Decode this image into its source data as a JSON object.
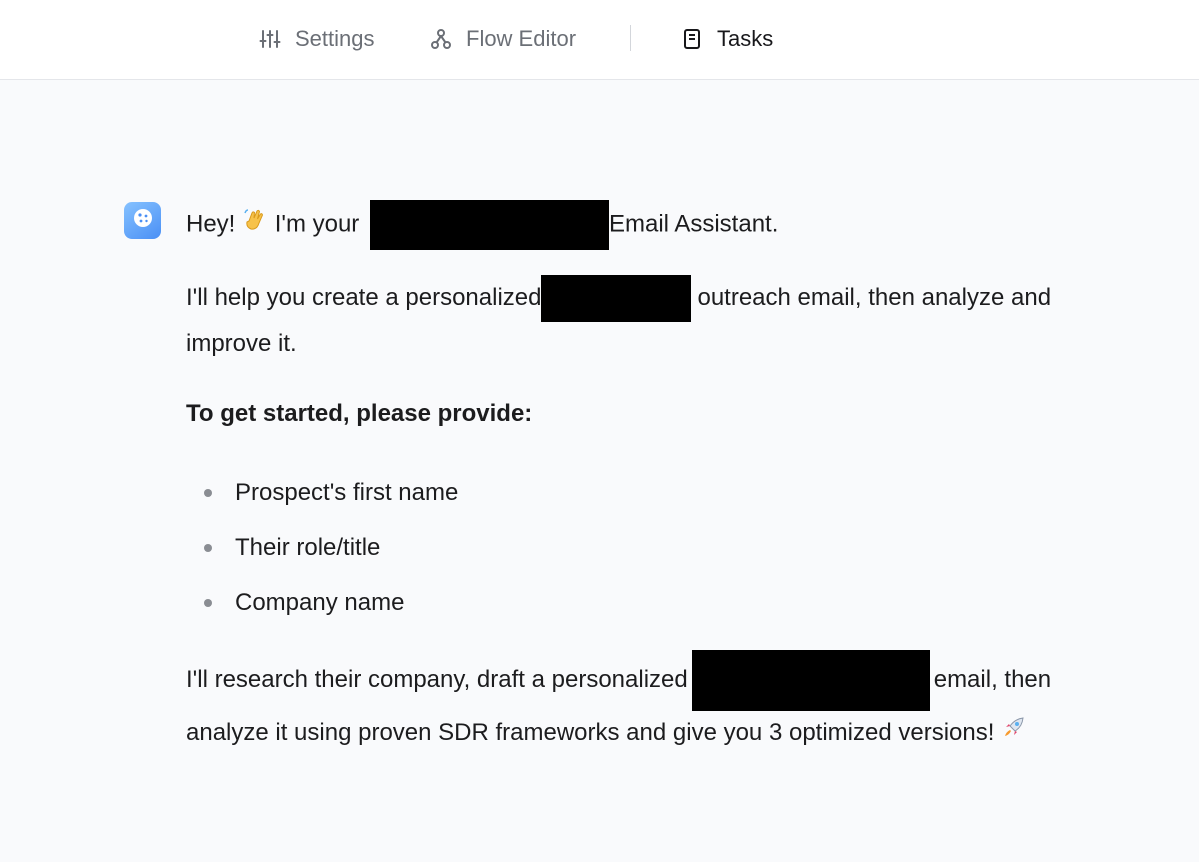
{
  "nav": {
    "tabs": [
      {
        "label": "Settings",
        "icon": "sliders-icon",
        "active": false
      },
      {
        "label": "Flow Editor",
        "icon": "flow-nodes-icon",
        "active": false
      },
      {
        "label": "Tasks",
        "icon": "notebook-icon",
        "active": true
      }
    ]
  },
  "message": {
    "avatar": "cookie-icon",
    "greeting_start": "Hey!",
    "greeting_mid": "I'm your",
    "greeting_end": "Email Assistant.",
    "intro_start": "I'll help you create a personalized",
    "intro_end": "outreach email, then analyze and improve it.",
    "heading": "To get started, please provide:",
    "bullets": [
      "Prospect's first name",
      "Their role/title",
      "Company name"
    ],
    "outro_start": "I'll research their company, draft a personalized",
    "outro_end": "email, then analyze it using proven SDR frameworks and give you 3 optimized versions!"
  },
  "colors": {
    "accent_avatar": "#4a8ff5",
    "redaction": "#000000",
    "background": "#f9fafc"
  }
}
